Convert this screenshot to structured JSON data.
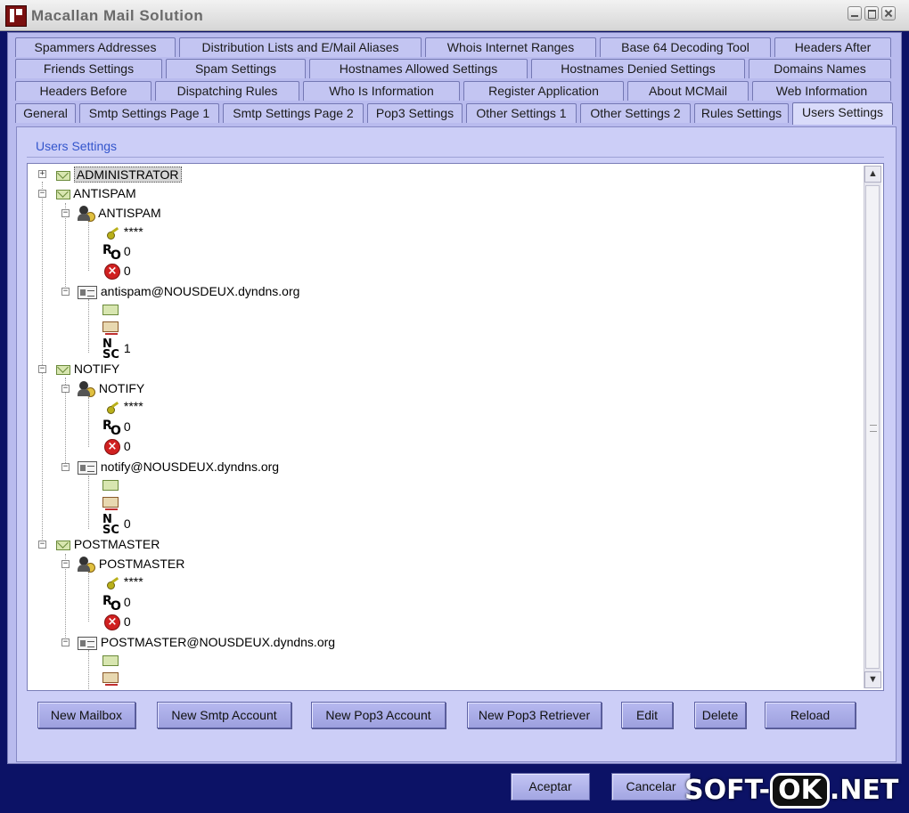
{
  "window": {
    "title": "Macallan Mail Solution"
  },
  "tabs": {
    "row1": [
      "Spammers Addresses",
      "Distribution Lists and E/Mail Aliases",
      "Whois Internet Ranges",
      "Base 64 Decoding Tool",
      "Headers After"
    ],
    "row2": [
      "Friends Settings",
      "Spam Settings",
      "Hostnames Allowed Settings",
      "Hostnames Denied Settings",
      "Domains Names"
    ],
    "row3": [
      "Headers Before",
      "Dispatching Rules",
      "Who Is Information",
      "Register Application",
      "About MCMail",
      "Web Information"
    ],
    "row4": [
      "General",
      "Smtp Settings Page 1",
      "Smtp Settings Page 2",
      "Pop3 Settings",
      "Other Settings 1",
      "Other Settings 2",
      "Rules Settings",
      "Users Settings"
    ],
    "active": "Users Settings"
  },
  "panel": {
    "group_label": "Users Settings"
  },
  "tree": {
    "administrator": "ADMINISTRATOR",
    "antispam": {
      "mailbox": "ANTISPAM",
      "user": "ANTISPAM",
      "password": "****",
      "ro_value": "0",
      "x_value": "0",
      "address": "antispam@NOUSDEUX.dyndns.org",
      "nsc_value": "1"
    },
    "notify": {
      "mailbox": "NOTIFY",
      "user": "NOTIFY",
      "password": "****",
      "ro_value": "0",
      "x_value": "0",
      "address": "notify@NOUSDEUX.dyndns.org",
      "nsc_value": "0"
    },
    "postmaster": {
      "mailbox": "POSTMASTER",
      "user": "POSTMASTER",
      "password": "****",
      "ro_value": "0",
      "x_value": "0",
      "address": "POSTMASTER@NOUSDEUX.dyndns.org"
    },
    "icons": {
      "ro_top": "R",
      "ro_bottom": "O",
      "nsc_top": "N",
      "nsc_bottom": "SC",
      "x": "×",
      "expand": "+",
      "collapse": "−"
    }
  },
  "buttons": {
    "new_mailbox": "New Mailbox",
    "new_smtp": "New Smtp Account",
    "new_pop3": "New Pop3 Account",
    "new_retriever": "New Pop3 Retriever",
    "edit": "Edit",
    "delete": "Delete",
    "reload": "Reload"
  },
  "footer": {
    "accept": "Aceptar",
    "cancel": "Cancelar"
  },
  "watermark": {
    "left": "SOFT-",
    "box": "OK",
    "right": ".NET"
  },
  "colors": {
    "frame": "#b9bbee",
    "background": "#0c1266",
    "label": "#3355cc"
  }
}
